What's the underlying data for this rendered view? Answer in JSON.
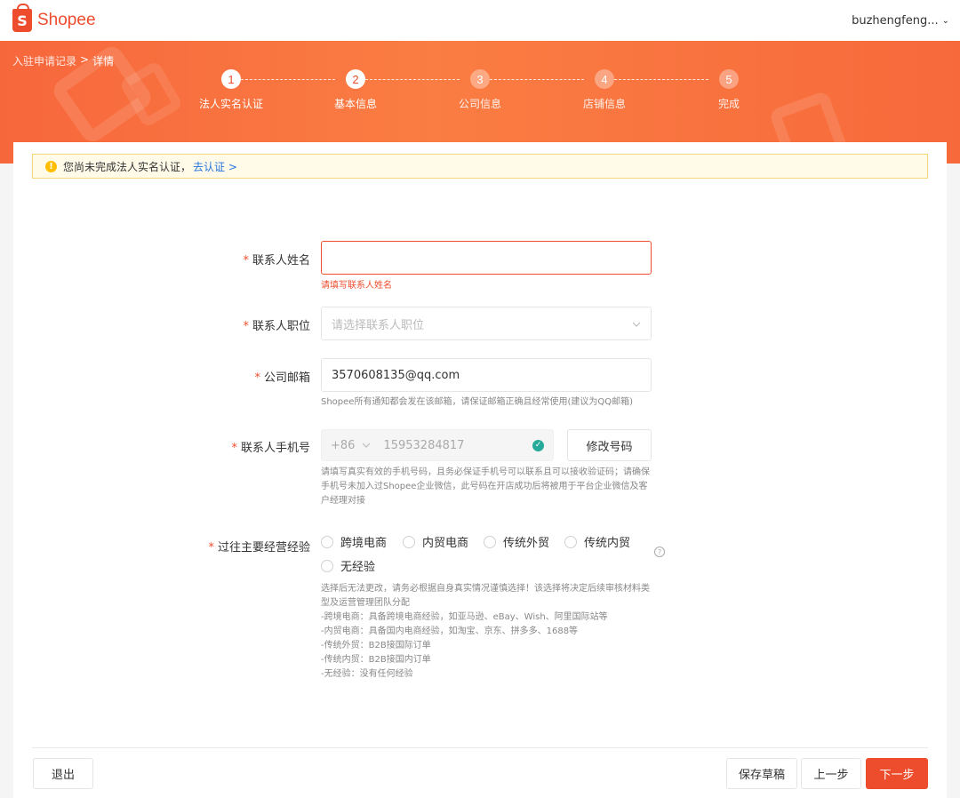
{
  "header": {
    "logo_letter": "S",
    "logo_text": "Shopee",
    "username": "buzhengfeng...",
    "user_chevron": "⌄"
  },
  "breadcrumb": {
    "parent": "入驻申请记录",
    "separator": ">",
    "current": "详情"
  },
  "steps": [
    {
      "num": "1",
      "label": "法人实名认证",
      "state": "done"
    },
    {
      "num": "2",
      "label": "基本信息",
      "state": "done"
    },
    {
      "num": "3",
      "label": "公司信息",
      "state": "todo"
    },
    {
      "num": "4",
      "label": "店铺信息",
      "state": "todo"
    },
    {
      "num": "5",
      "label": "完成",
      "state": "todo"
    }
  ],
  "notice": {
    "text": "您尚未完成法人实名认证，",
    "link": "去认证 >",
    "icon": "warning-icon"
  },
  "form": {
    "contact_name": {
      "label": "联系人姓名",
      "required_mark": "*",
      "value": "",
      "error": "请填写联系人姓名"
    },
    "contact_position": {
      "label": "联系人职位",
      "required_mark": "*",
      "placeholder": "请选择联系人职位"
    },
    "company_email": {
      "label": "公司邮箱",
      "required_mark": "*",
      "value": "3570608135@qq.com",
      "hint": "Shopee所有通知都会发在该邮箱，请保证邮箱正确且经常使用(建议为QQ邮箱)"
    },
    "contact_phone": {
      "label": "联系人手机号",
      "required_mark": "*",
      "country_code": "+86",
      "number": "15953284817",
      "change_button": "修改号码",
      "hint": "请填写真实有效的手机号码，且务必保证手机号可以联系且可以接收验证码；请确保手机号未加入过Shopee企业微信，此号码在开店成功后将被用于平台企业微信及客户经理对接"
    },
    "experience": {
      "label": "过往主要经营经验",
      "required_mark": "*",
      "options": [
        "跨境电商",
        "内贸电商",
        "传统外贸",
        "传统内贸",
        "无经验"
      ],
      "hint_lines": [
        "选择后无法更改，请务必根据自身真实情况谨慎选择！该选择将决定后续审核材料类型及运营管理团队分配",
        "-跨境电商：具备跨境电商经验，如亚马逊、eBay、Wish、阿里国际站等",
        "-内贸电商：具备国内电商经验，如淘宝、京东、拼多多、1688等",
        "-传统外贸：B2B接国际订单",
        "-传统内贸：B2B接国内订单",
        "-无经验：没有任何经验"
      ]
    }
  },
  "footer": {
    "exit": "退出",
    "save_draft": "保存草稿",
    "prev": "上一步",
    "next": "下一步"
  },
  "colors": {
    "brand": "#ee4d2d",
    "success": "#26aa99",
    "link": "#2673dd"
  }
}
